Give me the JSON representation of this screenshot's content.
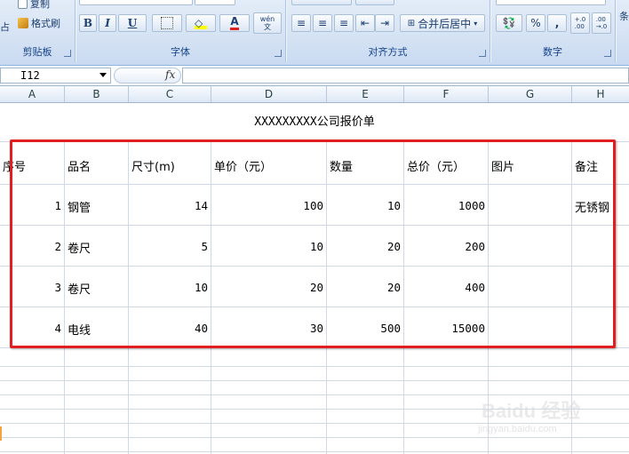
{
  "ribbon": {
    "clipboard": {
      "label": "剪贴板",
      "copy": "复制",
      "format_painter": "格式刷",
      "paste_fragment": "占"
    },
    "font": {
      "label": "字体",
      "bold": "B",
      "italic": "I",
      "underline": "U",
      "font_color": "A",
      "phonetic": "wén\n文"
    },
    "alignment": {
      "label": "对齐方式",
      "merge_center": "合并后居中"
    },
    "number": {
      "label": "数字",
      "percent": "%",
      "comma": ",",
      "increase_decimal": "+.0\n.00",
      "decrease_decimal": ".00\n→.0"
    },
    "styles": {
      "fragment": "条"
    }
  },
  "formula_bar": {
    "name_box": "I12",
    "fx": "fx",
    "formula": ""
  },
  "columns": [
    "A",
    "B",
    "C",
    "D",
    "E",
    "F",
    "G",
    "H"
  ],
  "sheet": {
    "title": "XXXXXXXXX公司报价单",
    "headers": [
      "序号",
      "品名",
      "尺寸(m)",
      "单价（元）",
      "数量",
      "总价（元）",
      "图片",
      "备注"
    ],
    "rows": [
      [
        "1",
        "钢管",
        "14",
        "100",
        "10",
        "1000",
        "",
        "无锈钢"
      ],
      [
        "2",
        "卷尺",
        "5",
        "10",
        "20",
        "200",
        "",
        ""
      ],
      [
        "3",
        "卷尺",
        "10",
        "20",
        "20",
        "400",
        "",
        ""
      ],
      [
        "4",
        "电线",
        "40",
        "30",
        "500",
        "15000",
        "",
        ""
      ]
    ]
  },
  "watermark": {
    "main": "Baidu 经验",
    "sub": "jingyan.baidu.com"
  },
  "colors": {
    "highlight_border": "#e02020",
    "ribbon_text": "#15428b",
    "gridline": "#d0d7e5"
  }
}
